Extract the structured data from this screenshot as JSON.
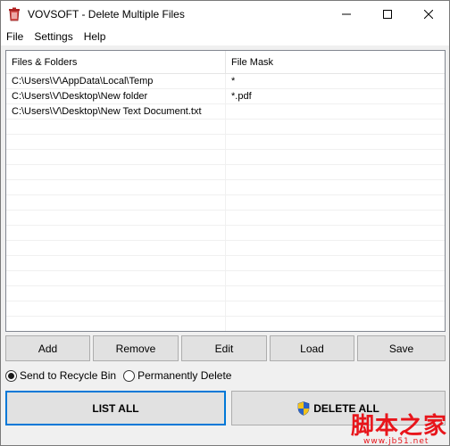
{
  "window": {
    "title": "VOVSOFT - Delete Multiple Files"
  },
  "menu": [
    "File",
    "Settings",
    "Help"
  ],
  "list": {
    "columns": [
      "Files & Folders",
      "File Mask"
    ],
    "rows": [
      {
        "path": "C:\\Users\\V\\AppData\\Local\\Temp",
        "mask": "*"
      },
      {
        "path": "C:\\Users\\V\\Desktop\\New folder",
        "mask": "*.pdf"
      },
      {
        "path": "C:\\Users\\V\\Desktop\\New Text Document.txt",
        "mask": ""
      }
    ],
    "empty_rows": 14
  },
  "buttons": {
    "add": "Add",
    "remove": "Remove",
    "edit": "Edit",
    "load": "Load",
    "save": "Save"
  },
  "mode": {
    "recycle": "Send to Recycle Bin",
    "permanent": "Permanently Delete",
    "selected": "recycle"
  },
  "actions": {
    "list_all": "LIST ALL",
    "delete_all": "DELETE ALL"
  },
  "watermark": {
    "main": "脚本之家",
    "url": "www.jb51.net"
  },
  "colors": {
    "accent": "#0078d7",
    "watermark": "#e8151b"
  }
}
